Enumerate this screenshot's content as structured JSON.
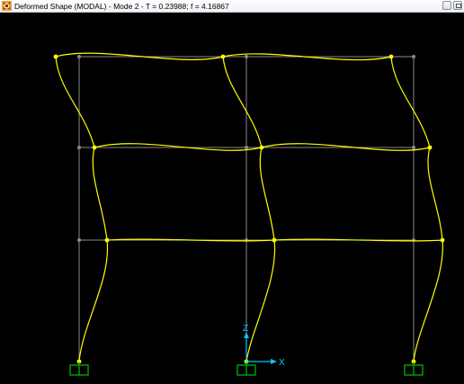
{
  "window": {
    "title": "Deformed Shape (MODAL) - Mode 2 - T = 0.23988;  f = 4.16867",
    "app_icon": "sap2000-app-icon",
    "restore_icon": "restore-window-icon"
  },
  "viewport": {
    "background": "#000000",
    "undeformed_color": "#8a8a8a",
    "deformed_color": "#ffff00",
    "support_color": "#00c000",
    "axis_color": "#00c8ff",
    "axis_z_label": "Z",
    "axis_x_label": "X"
  }
}
